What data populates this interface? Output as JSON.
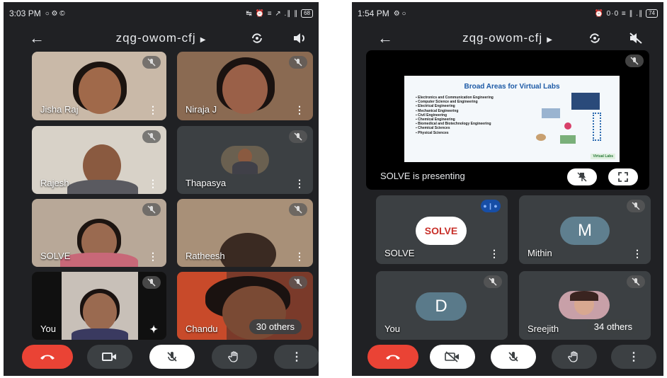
{
  "left": {
    "status": {
      "time": "3:03 PM",
      "icons": "○ ⚙ ©",
      "right_icons": "↹ ⏰ ≡ ↗ .∥ ∥",
      "battery": "68"
    },
    "header": {
      "title": "zqg-owom-cfj"
    },
    "participants": [
      {
        "name": "Jisha Raj"
      },
      {
        "name": "Niraja J"
      },
      {
        "name": "Rajesh"
      },
      {
        "name": "Thapasya"
      },
      {
        "name": "SOLVE"
      },
      {
        "name": "Ratheesh"
      },
      {
        "name": "You"
      },
      {
        "name": "Chandu"
      }
    ],
    "others": "30 others"
  },
  "right": {
    "status": {
      "time": "1:54 PM",
      "icons": "⚙ ○",
      "right_icons": "⏰ 0·0 ≡ ∥ .∥",
      "battery": "74"
    },
    "header": {
      "title": "zqg-owom-cfj"
    },
    "slide": {
      "title": "Broad Areas for Virtual Labs",
      "items": [
        "Electronics and Communication Engineering",
        "Computer Science and Engineering",
        "Electrical Engineering",
        "Mechanical Engineering",
        "Civil Engineering",
        "Chemical Engineering",
        "Biomedical and Biotechnology Engineering",
        "Chemical Sciences",
        "Physical Sciences"
      ],
      "logo_text": "Virtual Labs"
    },
    "presenting_text": "SOLVE is presenting",
    "participants": [
      {
        "name": "SOLVE",
        "avatar": "SOLVE"
      },
      {
        "name": "Mithin",
        "avatar": "M"
      },
      {
        "name": "You",
        "avatar": "D"
      },
      {
        "name": "Sreejith",
        "avatar": ""
      }
    ],
    "others": "34 others"
  },
  "colors": {
    "background": "#202124",
    "tile": "#3c4043",
    "end_call": "#ea4335",
    "slide_title": "#1d5aa6"
  }
}
